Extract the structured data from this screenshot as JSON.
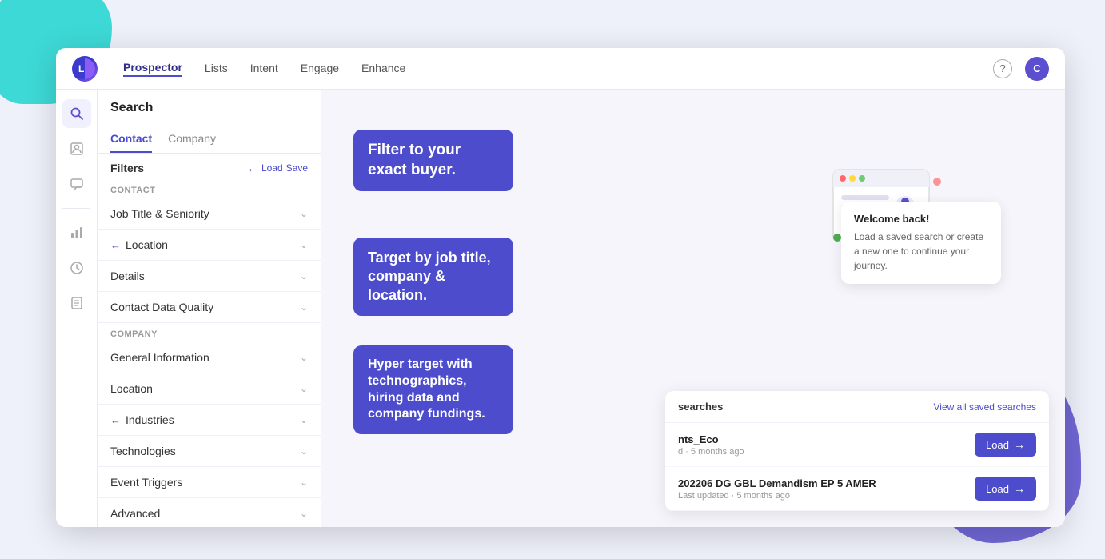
{
  "app": {
    "logo_text": "L",
    "nav": {
      "items": [
        {
          "label": "Prospector",
          "active": true
        },
        {
          "label": "Lists",
          "active": false
        },
        {
          "label": "Intent",
          "active": false
        },
        {
          "label": "Engage",
          "active": false
        },
        {
          "label": "Enhance",
          "active": false
        }
      ]
    },
    "help_icon": "?",
    "avatar_text": "C"
  },
  "sidebar_icons": [
    {
      "icon": "🔍",
      "label": "search",
      "active": true
    },
    {
      "icon": "👤",
      "label": "contact",
      "active": false
    },
    {
      "icon": "💬",
      "label": "chat",
      "active": false
    },
    {
      "icon": "📊",
      "label": "analytics",
      "active": false
    },
    {
      "icon": "⏱",
      "label": "history",
      "active": false
    },
    {
      "icon": "🗂",
      "label": "files",
      "active": false
    }
  ],
  "filter_panel": {
    "title": "Search",
    "tabs": [
      {
        "label": "Contact",
        "active": true
      },
      {
        "label": "Company",
        "active": false
      }
    ],
    "filters_label": "Filters",
    "load_label": "Load",
    "save_label": "Save",
    "contact_section_label": "Contact",
    "company_section_label": "Company",
    "contact_filters": [
      {
        "label": "Job Title & Seniority"
      },
      {
        "label": "Location"
      },
      {
        "label": "Details"
      },
      {
        "label": "Contact Data Quality"
      }
    ],
    "company_filters": [
      {
        "label": "General Information"
      },
      {
        "label": "Location"
      },
      {
        "label": "Industries"
      },
      {
        "label": "Technologies"
      },
      {
        "label": "Event Triggers"
      },
      {
        "label": "Advanced"
      }
    ]
  },
  "tooltips": [
    {
      "id": "bubble1",
      "text": "Filter to your exact buyer."
    },
    {
      "id": "bubble2",
      "text": "Target by job title, company & location."
    },
    {
      "id": "bubble3",
      "text": "Hyper target with technographics, hiring data and company fundings."
    }
  ],
  "welcome_card": {
    "title": "Welcome back!",
    "text": "Load a saved search or create a new one to continue your journey."
  },
  "saved_searches": {
    "title": "searches",
    "view_all": "View all saved searches",
    "items": [
      {
        "name": "nts_Eco",
        "meta": "d · 5 months ago",
        "load_label": "Load"
      },
      {
        "name": "202206 DG GBL Demandism EP 5 AMER",
        "meta": "Last updated · 5 months ago",
        "load_label": "Load"
      }
    ]
  }
}
